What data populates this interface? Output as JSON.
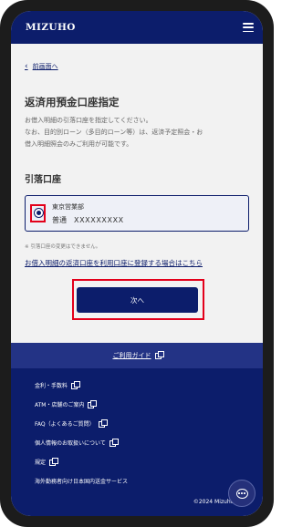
{
  "header": {
    "logo": "MIZUHO",
    "menu_icon": "hamburger-menu-icon"
  },
  "back_link": {
    "icon": "chevron-left-icon",
    "label": "前画面へ"
  },
  "page": {
    "title": "返済用預金口座指定",
    "description_line1": "お借入明細の引落口座を指定してください。",
    "description_line2": "なお、目的別ローン（多目的ローン等）は、返済予定照会・お",
    "description_line3": "借入明細照会のみご利用が可能です。"
  },
  "account_section": {
    "label": "引落口座",
    "account": {
      "selected": true,
      "branch": "東京営業部",
      "type": "普通",
      "number": "XXXXXXXXX"
    },
    "note": "※ 引落口座の変更はできません。",
    "register_link": "お借入明細の返済口座を利用口座に登録する場合はこちら"
  },
  "next_button": {
    "label": "次へ"
  },
  "footer": {
    "guide_link": "ご利用ガイド",
    "links": [
      {
        "label": "金利・手数料",
        "external": true
      },
      {
        "label": "ATM・店舗のご案内",
        "external": true
      },
      {
        "label": "FAQ（よくあるご質問）",
        "external": true
      },
      {
        "label": "個人情報のお取扱いについて",
        "external": true
      },
      {
        "label": "規定",
        "external": true
      },
      {
        "label": "海外勤務者向け日本国内送金サービス",
        "external": false
      }
    ],
    "copyright": "©2024 Mizuho Ba"
  },
  "chat_button": {
    "icon": "chat-bubble-icon"
  },
  "colors": {
    "brand_navy": "#0c1d6b",
    "highlight_red": "#e3001b",
    "background": "#f2f2f2"
  }
}
